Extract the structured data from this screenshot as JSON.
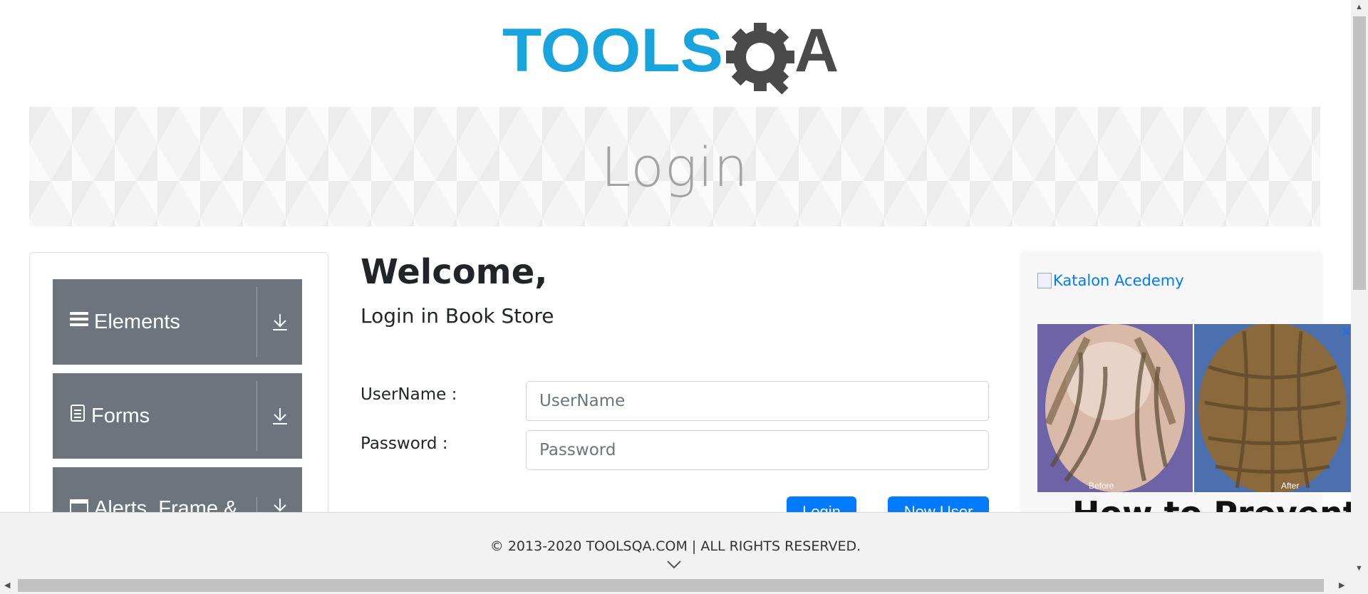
{
  "logo": {
    "text_left": "TOOLS",
    "text_right": "A",
    "brand_blue": "#1aa4dd",
    "brand_gray": "#4a4a4a"
  },
  "banner": {
    "title": "Login"
  },
  "sidebar": {
    "groups": [
      {
        "label": "Elements",
        "icon": "hamburger-icon"
      },
      {
        "label": "Forms",
        "icon": "document-icon"
      },
      {
        "label": "Alerts, Frame &",
        "icon": "window-icon"
      }
    ]
  },
  "main": {
    "welcome": "Welcome,",
    "subtitle": "Login in Book Store",
    "username_label": "UserName :",
    "username_placeholder": "UserName",
    "password_label": "Password :",
    "password_placeholder": "Password",
    "login_button": "Login",
    "new_user_button": "New User"
  },
  "ad": {
    "link_text": "Katalon Acedemy",
    "close_symbol": "✕",
    "before_label": "Before",
    "after_label": "After",
    "headline": "How to Prevent"
  },
  "footer": {
    "copyright": "© 2013-2020 TOOLSQA.COM | ALL RIGHTS RESERVED."
  },
  "colors": {
    "accent": "#007bff",
    "nav_bg": "#6c757d"
  }
}
